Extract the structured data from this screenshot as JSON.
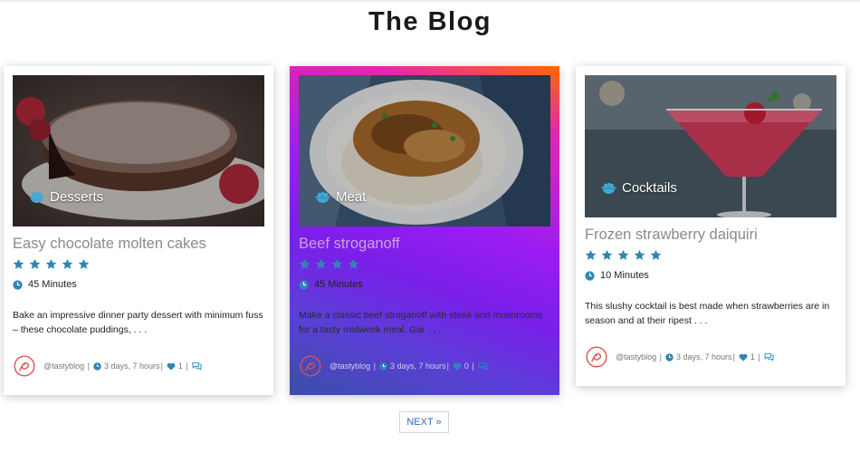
{
  "page": {
    "title": "The Blog"
  },
  "cards": [
    {
      "category": "Desserts",
      "title": "Easy chocolate molten cakes",
      "rating": 5,
      "time": "45 Minutes",
      "description": "Bake an impressive dinner party dessert with minimum fuss – these chocolate puddings, . . .",
      "author": "@tastyblog",
      "posted": "3 days, 7 hours",
      "likes": "1"
    },
    {
      "category": "Meat",
      "title": "Beef stroganoff",
      "rating": 4,
      "time": "45 Minutes",
      "description": "Make a classic beef stroganoff with steak and mushrooms for a tasty midweek meal. Gar . . .",
      "author": "@tastyblog",
      "posted": "3 days, 7 hours",
      "likes": "0"
    },
    {
      "category": "Cocktails",
      "title": "Frozen strawberry daiquiri",
      "rating": 5,
      "time": "10 Minutes",
      "description": "This slushy cocktail is best made when strawberries are in season and at their ripest . . .",
      "author": "@tastyblog",
      "posted": "3 days, 7 hours",
      "likes": "1"
    }
  ],
  "pagination": {
    "next_label": "NEXT »"
  },
  "colors": {
    "accent": "#2f86b4",
    "logo": "#d9534f",
    "link": "#2b6cc7"
  },
  "icons": {
    "category": "bowl-icon",
    "time": "clock-icon",
    "likes": "heart-icon",
    "comments": "comment-icon"
  }
}
